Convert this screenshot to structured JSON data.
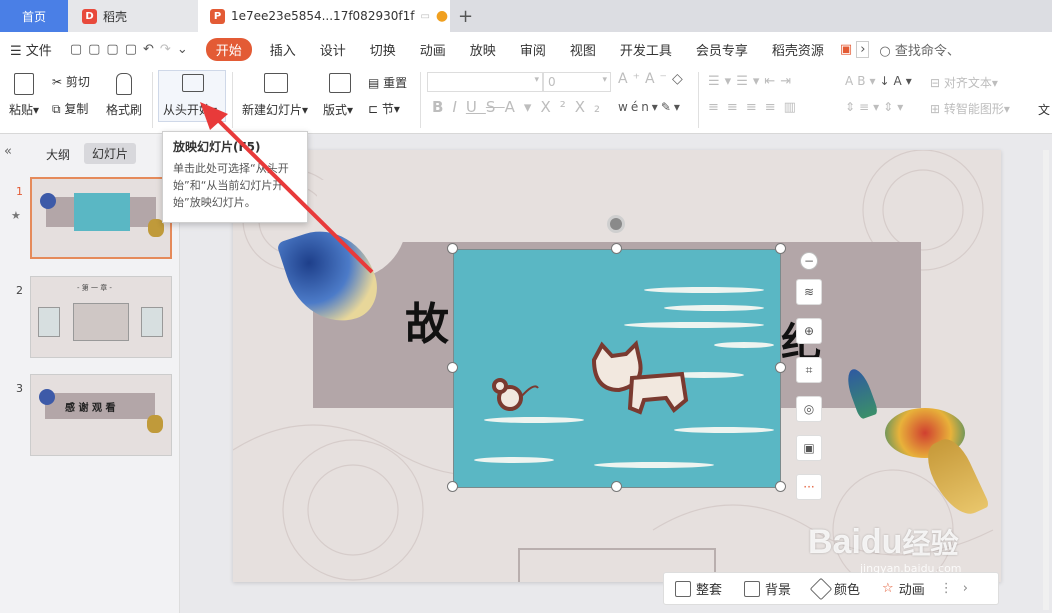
{
  "tabs": {
    "home": "首页",
    "app": "稻壳",
    "doc": "1e7ee23e5854...17f082930f1f",
    "add": "+"
  },
  "menu": {
    "file": "文件",
    "items": [
      "开始",
      "插入",
      "设计",
      "切换",
      "动画",
      "放映",
      "审阅",
      "视图",
      "开发工具",
      "会员专享",
      "稻壳资源"
    ],
    "search": "查找命令、"
  },
  "ribbon": {
    "paste": "粘贴",
    "cut": "剪切",
    "copy": "复制",
    "format_painter": "格式刷",
    "from_start": "从头开始",
    "new_slide": "新建幻灯片",
    "layout": "版式",
    "reset": "重置",
    "section": "节",
    "font_size": "0",
    "align_text": "对齐文本",
    "smart_shape": "转智能图形",
    "text": "文"
  },
  "panel": {
    "outline": "大纲",
    "slides": "幻灯片",
    "nums": [
      "1",
      "2",
      "3"
    ],
    "thumb2_title": "- 第 一 章 -",
    "thumb3_title": "感 谢 观 看"
  },
  "tooltip": {
    "title": "放映幻灯片(F5)",
    "body": "单击此处可选择“从头开始”和“从当前幻灯片开始”放映幻灯片。"
  },
  "slide": {
    "title_left": "故",
    "title_right": "纪"
  },
  "bottom": {
    "fit": "整套",
    "bg": "背景",
    "color": "颜色",
    "anim": "动画",
    "more": "⋮"
  },
  "watermark": {
    "brand": "Baidu",
    "product": "经验",
    "url": "jingyan.baidu.com"
  },
  "colors": {
    "accent": "#e35b35",
    "tab_blue": "#4a7fe6",
    "teal": "#5ab7c4",
    "mauve": "#b3a6a8"
  }
}
